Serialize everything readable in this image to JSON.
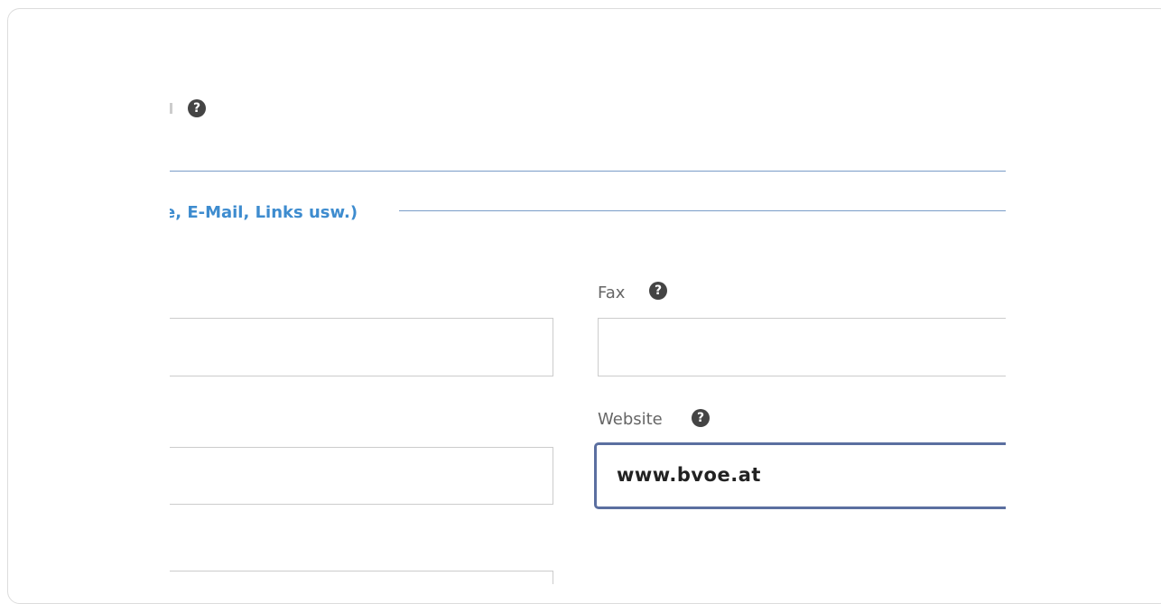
{
  "section": {
    "legend": "e, E-Mail, Links usw.)"
  },
  "fields": {
    "fax": {
      "label": "Fax",
      "value": ""
    },
    "website": {
      "label": "Website",
      "value": "www.bvoe.at"
    }
  },
  "icons": {
    "help": "?"
  }
}
